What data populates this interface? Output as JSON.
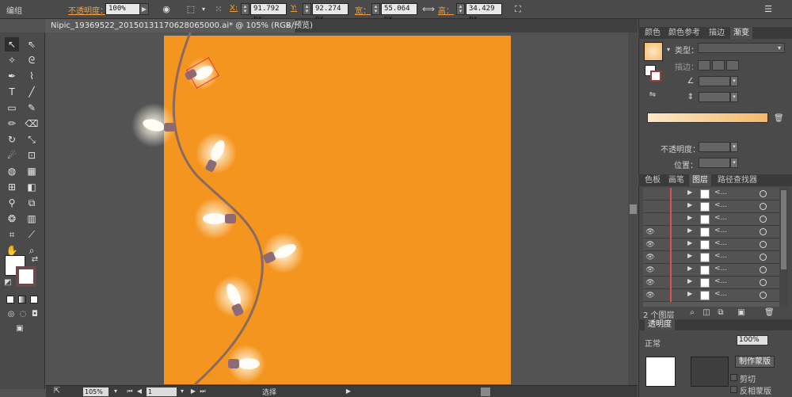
{
  "control_bar": {
    "selection_label": "编组",
    "opacity_label": "不透明度：",
    "opacity_value": "100%",
    "x_label": "X:",
    "x_value": "91.792 px",
    "y_label": "Y:",
    "y_value": "92.274 px",
    "w_label": "宽：",
    "w_value": "55.064 px",
    "h_label": "高：",
    "h_value": "34.429 px"
  },
  "document": {
    "tab_title": "Nipic_19369522_20150131170628065000.ai* @ 105% (RGB/预览)",
    "close_glyph": "×"
  },
  "status_bar": {
    "zoom": "105%",
    "page": "1",
    "tool_status": "选择"
  },
  "color_panel": {
    "tabs": [
      "颜色",
      "颜色参考",
      "描边",
      "渐变"
    ],
    "active_tab": "渐变",
    "type_label": "类型：",
    "stroke_label": "描边：",
    "opacity_label": "不透明度：",
    "position_label": "位置：",
    "gradient_start": "#fde7c6",
    "gradient_end": "#f6b96a"
  },
  "layers_panel": {
    "tabs": [
      "色板",
      "画笔",
      "图层",
      "路径查找器"
    ],
    "active_tab": "图层",
    "rows": [
      {
        "name": "<...",
        "visible": false
      },
      {
        "name": "<...",
        "visible": false
      },
      {
        "name": "<...",
        "visible": false
      },
      {
        "name": "<...",
        "visible": true
      },
      {
        "name": "<...",
        "visible": true
      },
      {
        "name": "<...",
        "visible": true
      },
      {
        "name": "<...",
        "visible": true
      },
      {
        "name": "<...",
        "visible": true
      },
      {
        "name": "<...",
        "visible": true
      }
    ],
    "footer_count": "2 个图层"
  },
  "transparency_panel": {
    "title": "透明度",
    "mode": "正常",
    "opacity": "100%",
    "make_mask_button": "制作蒙版",
    "clip_label": "剪切",
    "invert_mask_label": "反相蒙版"
  },
  "colors": {
    "artboard": "#f4951f",
    "wire": "#8a6a5e",
    "bulb": "#fffdf5",
    "socket": "#8c6a78"
  }
}
